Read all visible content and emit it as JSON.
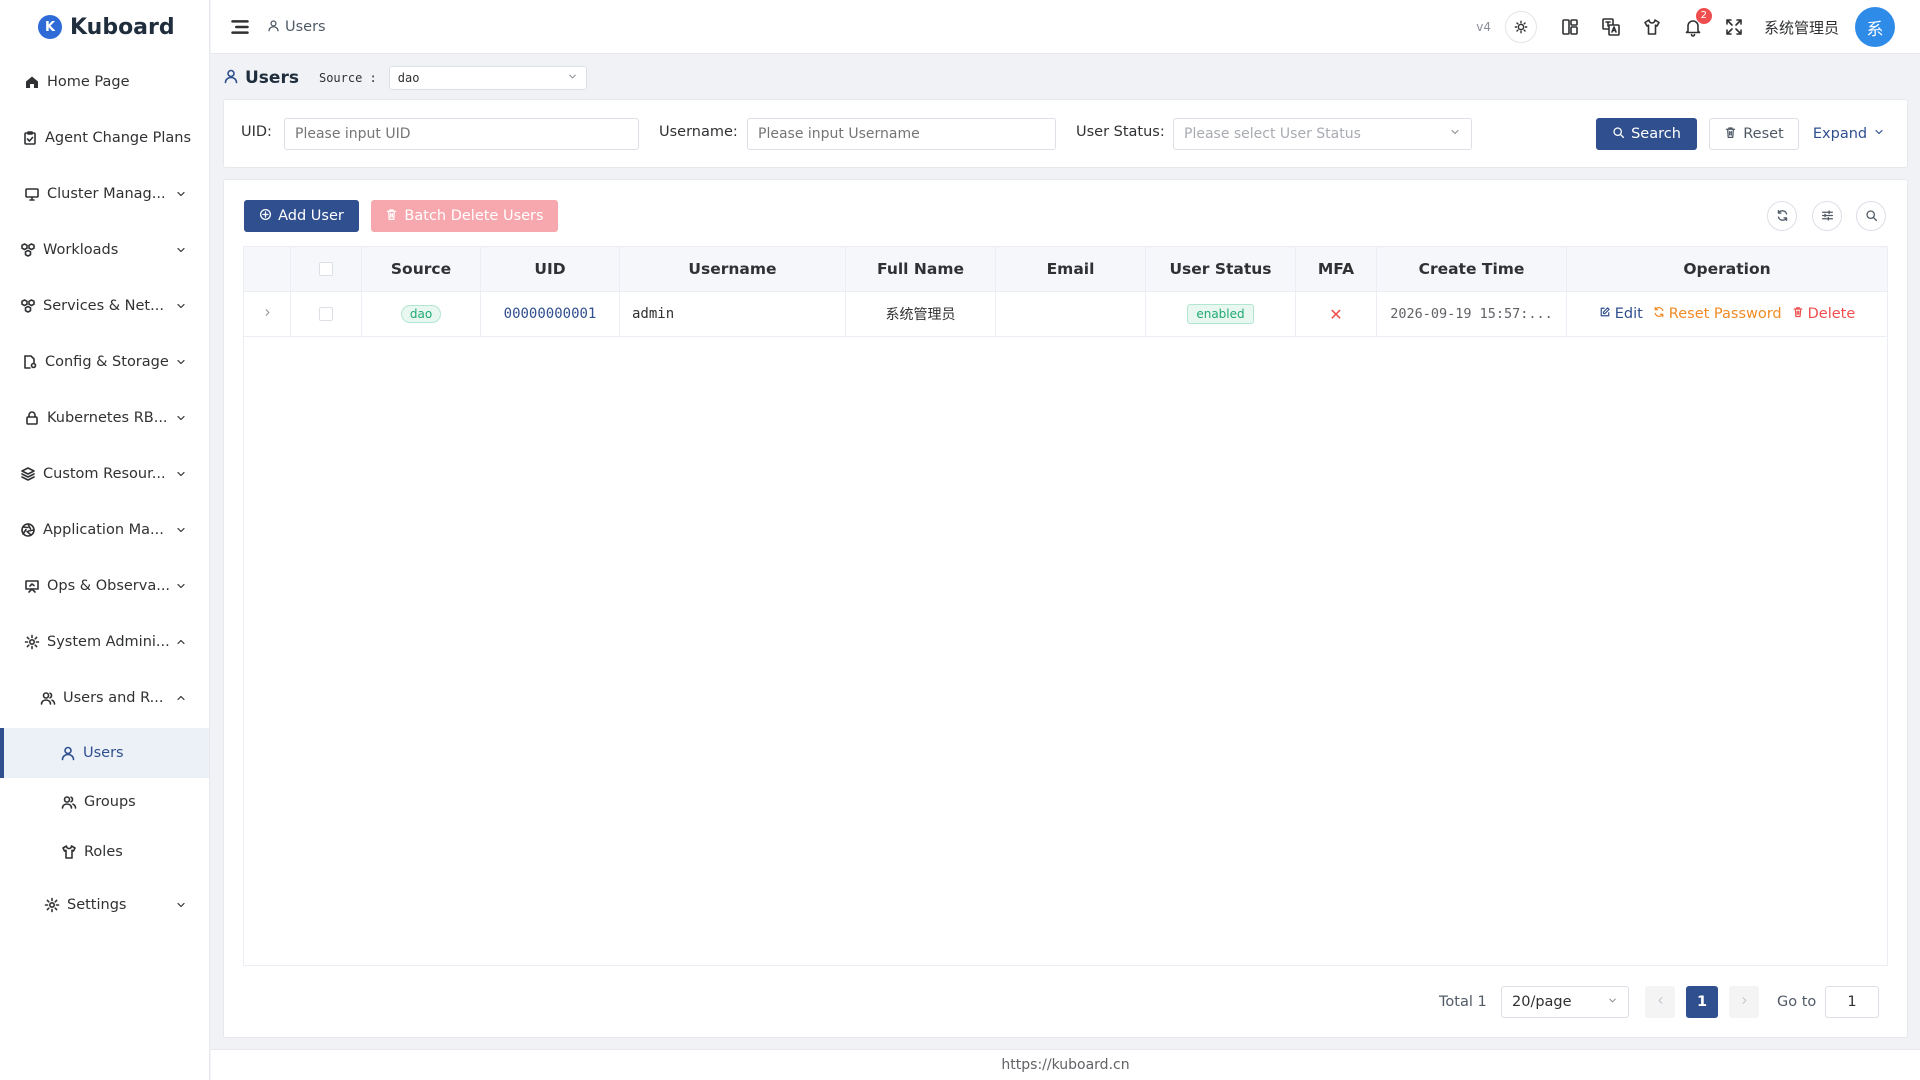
{
  "app": {
    "name": "Kuboard",
    "logo_letter": "K",
    "brand_color": "#2f4f8e"
  },
  "sidebar": {
    "items": [
      {
        "label": "Home Page",
        "icon": "home-icon"
      },
      {
        "label": "Agent Change Plans",
        "icon": "clipboard-check-icon"
      },
      {
        "label": "Cluster Manag...",
        "icon": "monitor-icon"
      },
      {
        "label": "Workloads",
        "icon": "cubes-icon"
      },
      {
        "label": "Services & Net...",
        "icon": "cubes-icon"
      },
      {
        "label": "Config & Storage",
        "icon": "file-settings-icon"
      },
      {
        "label": "Kubernetes RB...",
        "icon": "lock-icon"
      },
      {
        "label": "Custom Resour...",
        "icon": "layers-icon"
      },
      {
        "label": "Application Ma...",
        "icon": "aperture-icon"
      },
      {
        "label": "Ops & Observa...",
        "icon": "presentation-icon"
      },
      {
        "label": "System Admini...",
        "icon": "gear-icon"
      },
      {
        "label": "Users and R...",
        "icon": "users-icon"
      },
      {
        "label": "Users",
        "icon": "user-icon"
      },
      {
        "label": "Groups",
        "icon": "users-icon"
      },
      {
        "label": "Roles",
        "icon": "tshirt-icon"
      },
      {
        "label": "Settings",
        "icon": "gear-icon"
      }
    ]
  },
  "header": {
    "breadcrumb": "Users",
    "version": "v4",
    "notification_count": "2",
    "user_name": "系统管理员",
    "avatar_char": "系"
  },
  "page": {
    "title": "Users",
    "source_label": "Source :",
    "source_value": "dao"
  },
  "search": {
    "uid_label": "UID:",
    "uid_placeholder": "Please input UID",
    "username_label": "Username:",
    "username_placeholder": "Please input Username",
    "status_label": "User Status:",
    "status_placeholder": "Please select User Status",
    "search_btn": "Search",
    "reset_btn": "Reset",
    "expand_btn": "Expand"
  },
  "toolbar": {
    "add_user": "Add User",
    "batch_delete": "Batch Delete Users"
  },
  "table": {
    "columns": [
      "Source",
      "UID",
      "Username",
      "Full Name",
      "Email",
      "User Status",
      "MFA",
      "Create Time",
      "Operation"
    ],
    "rows": [
      {
        "source": "dao",
        "uid": "00000000001",
        "username": "admin",
        "full_name": "系统管理员",
        "email": "",
        "status": "enabled",
        "mfa": "✕",
        "create_time": "2026-09-19 15:57:...",
        "op_edit": "Edit",
        "op_reset": "Reset Password",
        "op_delete": "Delete"
      }
    ]
  },
  "pagination": {
    "total": "Total 1",
    "page_size": "20/page",
    "current_page": "1",
    "goto_label": "Go to",
    "goto_value": "1"
  },
  "footer": {
    "url": "https://kuboard.cn"
  }
}
